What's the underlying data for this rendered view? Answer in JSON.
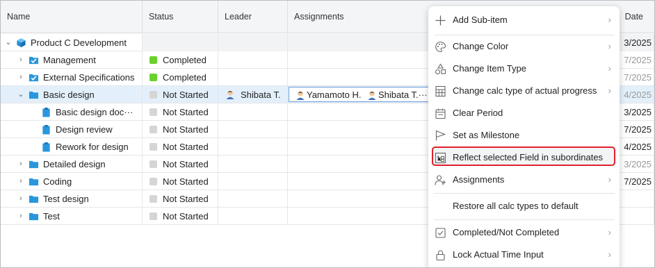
{
  "columns": {
    "name": "Name",
    "status": "Status",
    "leader": "Leader",
    "assignments": "Assignments",
    "date": "Date"
  },
  "rows": [
    {
      "name": "Product C Development",
      "status": "",
      "leader": "",
      "date": "3/2025"
    },
    {
      "name": "Management",
      "status": "Completed",
      "leader": "",
      "date": "7/2025"
    },
    {
      "name": "External Specifications",
      "status": "Completed",
      "leader": "",
      "date": "7/2025"
    },
    {
      "name": "Basic design",
      "status": "Not Started",
      "leader": "Shibata T.",
      "assign1": "Yamamoto H.",
      "assign2": "Shibata T.···",
      "date": "4/2025"
    },
    {
      "name": "Basic design doc···",
      "status": "Not Started",
      "leader": "",
      "date": "3/2025"
    },
    {
      "name": "Design review",
      "status": "Not Started",
      "leader": "",
      "date": "7/2025"
    },
    {
      "name": "Rework for design",
      "status": "Not Started",
      "leader": "",
      "date": "4/2025"
    },
    {
      "name": "Detailed design",
      "status": "Not Started",
      "leader": "",
      "date": "3/2025"
    },
    {
      "name": "Coding",
      "status": "Not Started",
      "leader": "",
      "date": "7/2025"
    },
    {
      "name": "Test design",
      "status": "Not Started",
      "leader": "",
      "date": ""
    },
    {
      "name": "Test",
      "status": "Not Started",
      "leader": "",
      "date": ""
    }
  ],
  "menu": [
    {
      "label": "Add Sub-item",
      "icon": "plus-icon",
      "arrow": "›"
    },
    {
      "label": "Change Color",
      "icon": "palette-icon",
      "arrow": "›"
    },
    {
      "label": "Change Item Type",
      "icon": "shapes-icon",
      "arrow": "›"
    },
    {
      "label": "Change calc type of actual progress",
      "icon": "calculator-icon",
      "arrow": "›"
    },
    {
      "label": "Clear Period",
      "icon": "calendar-icon",
      "arrow": ""
    },
    {
      "label": "Set as Milestone",
      "icon": "flag-icon",
      "arrow": ""
    },
    {
      "label": "Reflect selected Field in subordinates",
      "icon": "hierarchy-icon",
      "arrow": ""
    },
    {
      "label": "Assignments",
      "icon": "person-add-icon",
      "arrow": "›"
    },
    {
      "label": "Restore all calc types to default",
      "icon": "",
      "arrow": ""
    },
    {
      "label": "Completed/Not Completed",
      "icon": "checkbox-icon",
      "arrow": "›"
    },
    {
      "label": "Lock Actual Time Input",
      "icon": "lock-icon",
      "arrow": "›"
    }
  ],
  "colors": {
    "completed": "#6ad12c",
    "not_started": "#d5d5d5",
    "folder": "#2a97dc",
    "highlight_border": "#e0202a"
  }
}
